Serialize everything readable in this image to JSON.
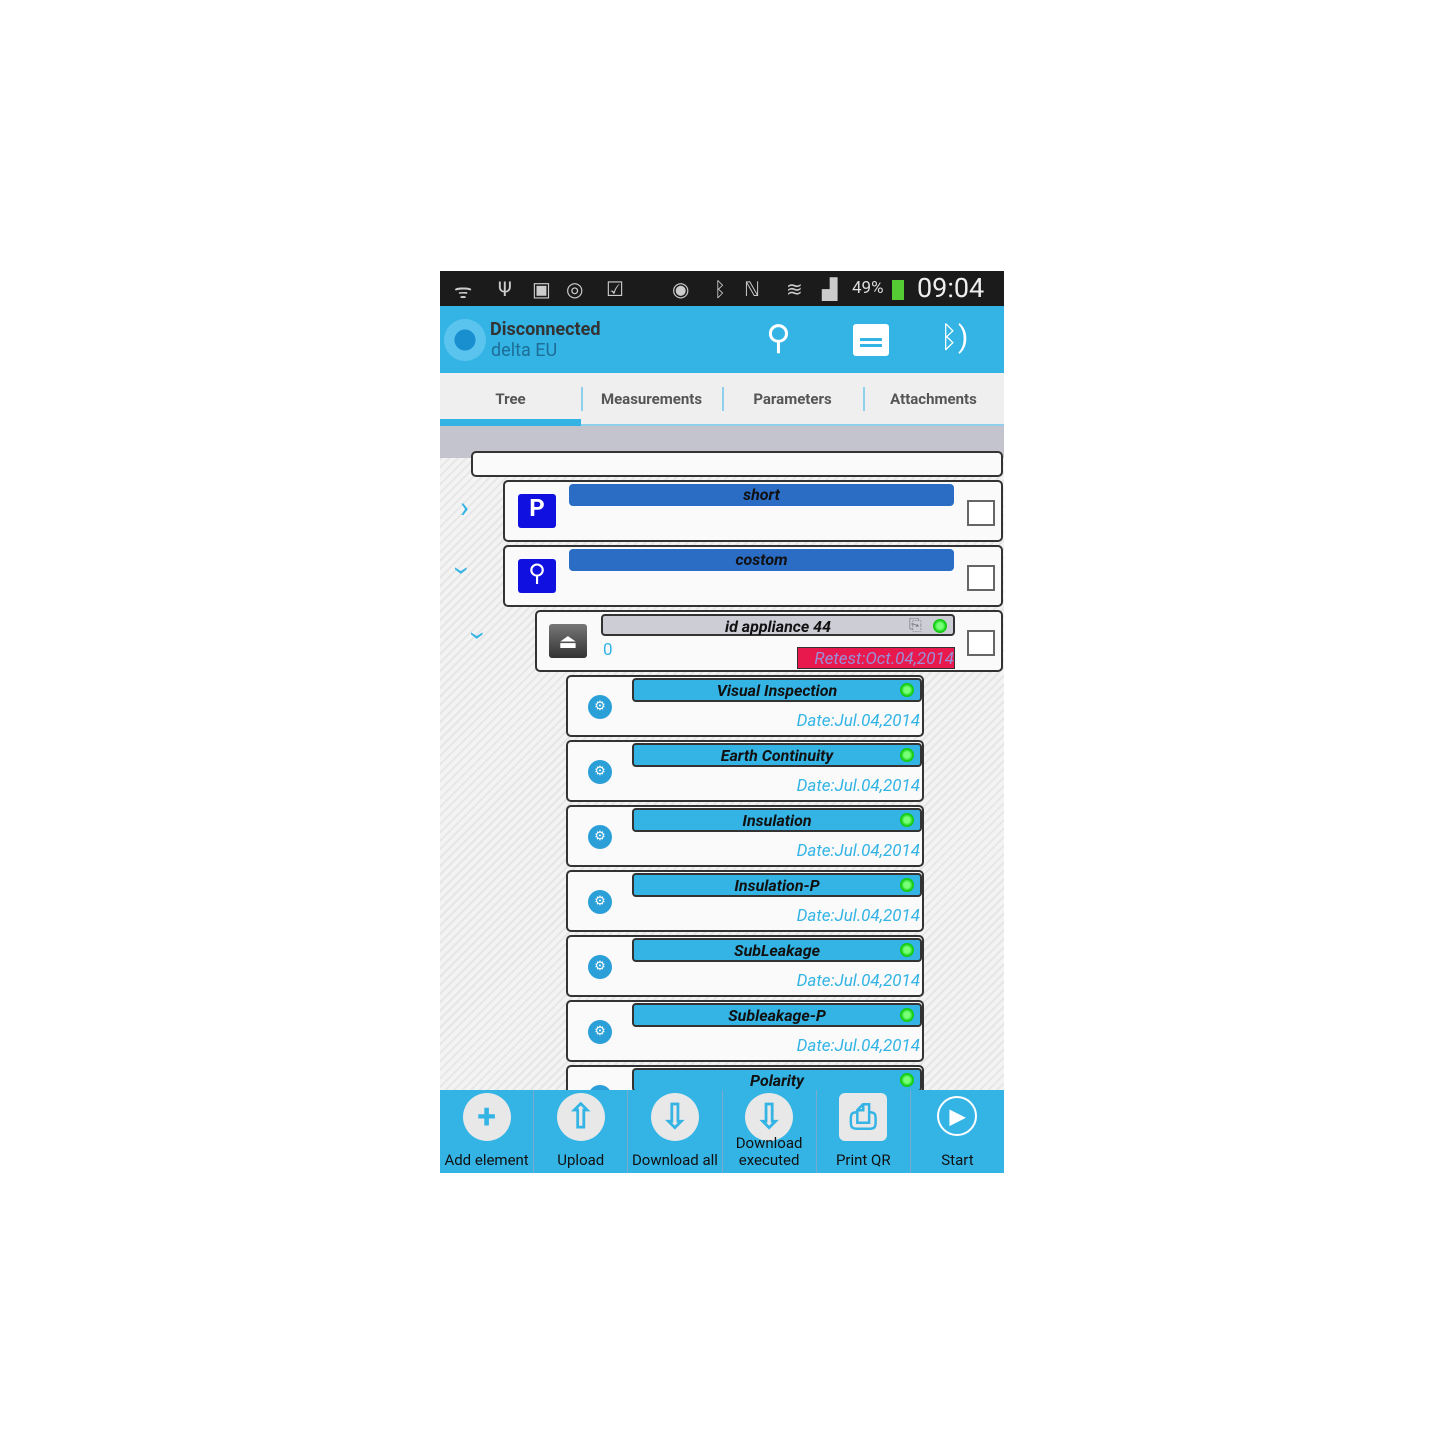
{
  "status_bar": {
    "battery": "49%",
    "time": "09:04"
  },
  "header": {
    "title": "Disconnected",
    "subtitle": "delta EU"
  },
  "tabs": [
    {
      "label": "Tree",
      "active": true
    },
    {
      "label": "Measurements"
    },
    {
      "label": "Parameters"
    },
    {
      "label": "Attachments"
    }
  ],
  "tree": {
    "groups": [
      {
        "label": "short",
        "expanded": false
      },
      {
        "label": "costom",
        "expanded": true
      }
    ],
    "appliance": {
      "label": "id appliance 44",
      "count": "0",
      "retest": "Retest:Oct.04,2014"
    },
    "tests": [
      {
        "label": "Visual Inspection",
        "date": "Date:Jul.04,2014"
      },
      {
        "label": "Earth Continuity",
        "date": "Date:Jul.04,2014"
      },
      {
        "label": "Insulation",
        "date": "Date:Jul.04,2014"
      },
      {
        "label": "Insulation-P",
        "date": "Date:Jul.04,2014"
      },
      {
        "label": "SubLeakage",
        "date": "Date:Jul.04,2014"
      },
      {
        "label": "Subleakage-P",
        "date": "Date:Jul.04,2014"
      },
      {
        "label": "Polarity",
        "date": ""
      }
    ]
  },
  "bottom_bar": [
    {
      "label": "Add element",
      "icon": "plus"
    },
    {
      "label": "Upload",
      "icon": "upload"
    },
    {
      "label": "Download all",
      "icon": "download"
    },
    {
      "label": "Download executed",
      "icon": "download-executed"
    },
    {
      "label": "Print QR",
      "icon": "printer"
    },
    {
      "label": "Start",
      "icon": "play"
    }
  ],
  "colors": {
    "accent": "#33b4e5",
    "group_bar": "#2b6cc4",
    "retest": "#e8194c"
  }
}
